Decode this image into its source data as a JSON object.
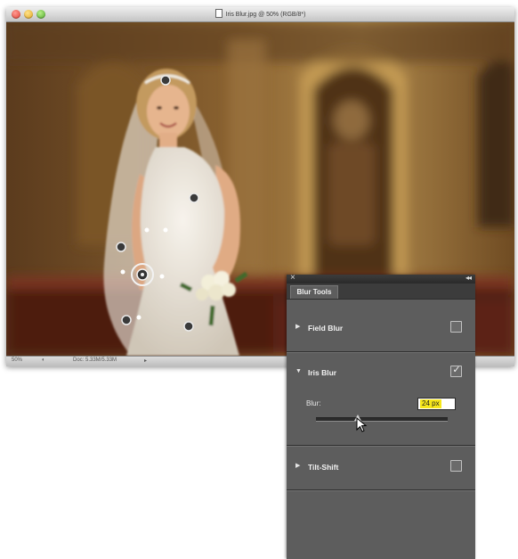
{
  "window": {
    "title": "Iris Blur.jpg @ 50% (RGB/8*)",
    "status_zoom": "50%",
    "status_doc": "Doc: 5.33M/5.33M"
  },
  "panel": {
    "tab_label": "Blur Tools",
    "close_glyph": "×",
    "collapse_glyph": "◂◂",
    "sections": {
      "field_blur": {
        "label": "Field Blur",
        "checked": false
      },
      "iris_blur": {
        "label": "Iris Blur",
        "checked": true,
        "blur_label": "Blur:",
        "blur_value": "24 px"
      },
      "tilt_shift": {
        "label": "Tilt-Shift",
        "checked": false
      }
    },
    "triangle_right": "▶",
    "triangle_down": "▼",
    "check_glyph": "✓"
  },
  "icons": [
    "document-icon",
    "close-icon",
    "collapse-icon",
    "disclosure-triangle-icon",
    "checkbox-icon",
    "arrow-cursor-icon",
    "blur-pin-icon",
    "ellipse-handle-icon"
  ],
  "colors": {
    "panel_bg": "#5d5d5d",
    "panel_header": "#2a2a2a",
    "value_highlight": "#f6e71a"
  }
}
